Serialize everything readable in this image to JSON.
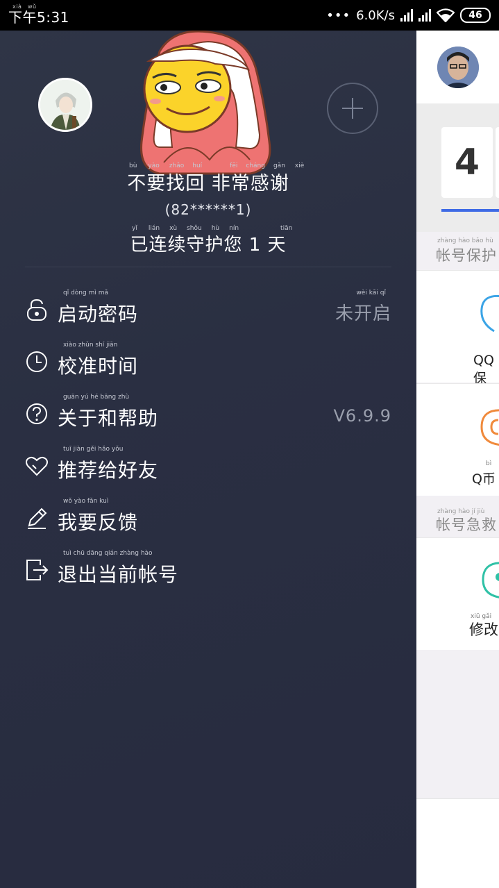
{
  "status_bar": {
    "time": "下午5:31",
    "time_pinyin": [
      "xià",
      "wǔ"
    ],
    "dots": "•••",
    "net_speed": "6.0K/s",
    "battery": "46"
  },
  "profile": {
    "nickname": "不要找回 非常感谢",
    "nickname_pinyin": [
      "bù",
      "yào",
      "zhǎo",
      "huí",
      "fēi",
      "cháng",
      "gǎn",
      "xiè"
    ],
    "account": "(82******1)",
    "guard_text": "已连续守护您 1 天",
    "guard_pinyin": [
      "yǐ",
      "lián",
      "xù",
      "shǒu",
      "hù",
      "nín",
      "tiān"
    ]
  },
  "menu": {
    "items": [
      {
        "label": "启动密码",
        "pinyin": "qǐ  dòng   mì   mǎ",
        "value": "未开启",
        "value_pinyin": "wèi  kāi   qǐ",
        "icon": "lock-icon"
      },
      {
        "label": "校准时间",
        "pinyin": "xiào zhǔn  shí   jiān",
        "value": "",
        "icon": "clock-icon"
      },
      {
        "label": "关于和帮助",
        "pinyin": "guān  yú   hé  bāng  zhù",
        "value": "V6.9.9",
        "icon": "help-icon"
      },
      {
        "label": "推荐给好友",
        "pinyin": "tuī  jiàn  gěi  hǎo  yǒu",
        "value": "",
        "icon": "heart-icon"
      },
      {
        "label": "我要反馈",
        "pinyin": "wǒ  yào  fǎn  kuì",
        "value": "",
        "icon": "pencil-icon"
      },
      {
        "label": "退出当前帐号",
        "pinyin": "tuì  chū  dāng  qián  zhàng  hào",
        "value": "",
        "icon": "logout-icon"
      }
    ]
  },
  "background": {
    "token_digit": "4",
    "section_protect": "帐号保护",
    "section_protect_pinyin": "zhàng  hào  bǎo  hù",
    "card_qq": "QQ保",
    "card_qb": "Q币",
    "card_qb_pinyin": "bì",
    "section_rescue": "帐号急救",
    "section_rescue_pinyin": "zhàng  hào   jí    jiù",
    "card_modify": "修改",
    "card_modify_pinyin": "xiū  gǎi"
  },
  "colors": {
    "drawer_bg": "#2a2f42",
    "accent_blue": "#3f6be5",
    "muted_text": "#9a9fad"
  }
}
